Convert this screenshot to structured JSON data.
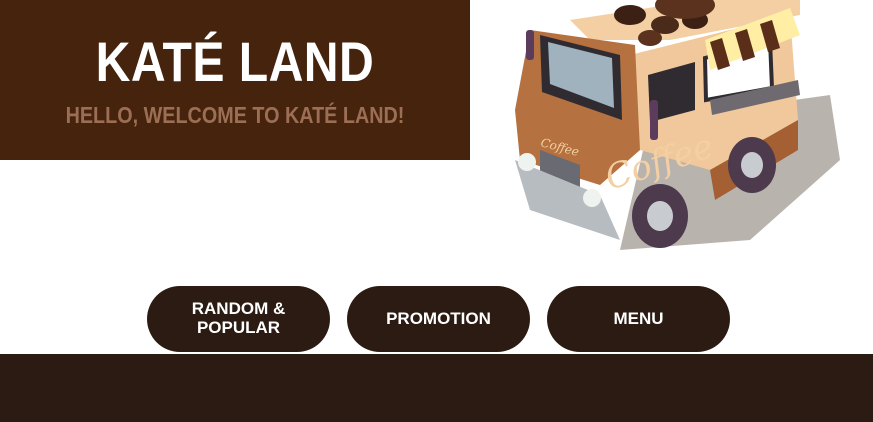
{
  "hero": {
    "title": "KATÉ LAND",
    "subtitle": "HELLO, WELCOME TO KATÉ LAND!"
  },
  "illustration": {
    "subject": "coffee-truck",
    "truck_label": "Coffee",
    "truck_small_label": "Coffee"
  },
  "nav": {
    "buttons": [
      {
        "label": "RANDOM & POPULAR"
      },
      {
        "label": "PROMOTION"
      },
      {
        "label": "MENU"
      }
    ]
  },
  "colors": {
    "banner": "#45230d",
    "button": "#2b1b12",
    "footer": "#2b1b12",
    "subtitle": "#9c6f55"
  }
}
